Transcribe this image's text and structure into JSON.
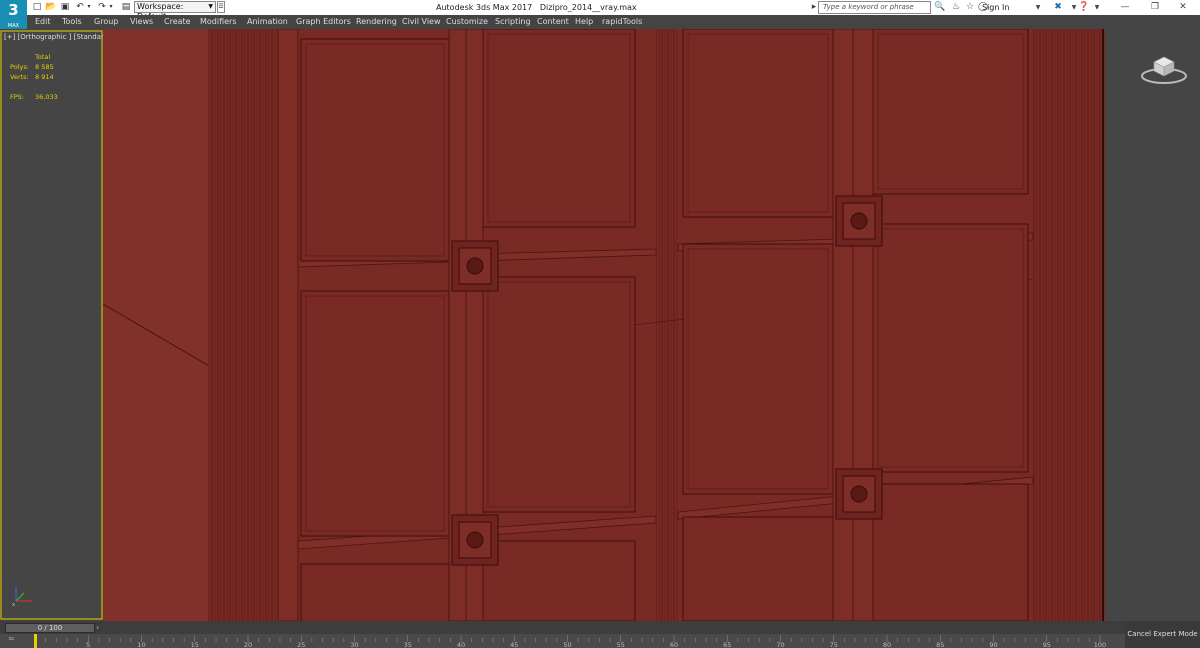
{
  "app": {
    "logo_text": "3",
    "logo_sub": "MAX",
    "title": "Autodesk 3ds Max 2017",
    "filename": "Dizipro_2014__vray.max"
  },
  "workspace": {
    "label": "Workspace: Default"
  },
  "search": {
    "placeholder": "Type a keyword or phrase"
  },
  "account": {
    "signin_label": "Sign In"
  },
  "menu": [
    "Edit",
    "Tools",
    "Group",
    "Views",
    "Create",
    "Modifiers",
    "Animation",
    "Graph Editors",
    "Rendering",
    "Civil View",
    "Customize",
    "Scripting",
    "Content",
    "Help",
    "rapidTools"
  ],
  "viewport": {
    "label": "[+] [Orthographic ] [Standard ] [Clay + Edged Faces ]",
    "stats": {
      "total_label": "Total",
      "polys_label": "Polys:",
      "polys_value": "8 585",
      "verts_label": "Verts:",
      "verts_value": "8 914",
      "fps_label": "FPS:",
      "fps_value": "36,033"
    }
  },
  "timeline": {
    "slider_label": "0 / 100",
    "ticks": [
      "5",
      "10",
      "15",
      "20",
      "25",
      "30",
      "35",
      "40",
      "45",
      "50",
      "55",
      "60",
      "65",
      "70",
      "75",
      "80",
      "85",
      "90",
      "95",
      "100"
    ]
  },
  "status": {
    "cancel_expert_label": "Cancel Expert Mode"
  },
  "colors": {
    "viewport_clay": "#7a2a24",
    "stats_text": "#e8d000",
    "logo": "#1a8fb4"
  }
}
